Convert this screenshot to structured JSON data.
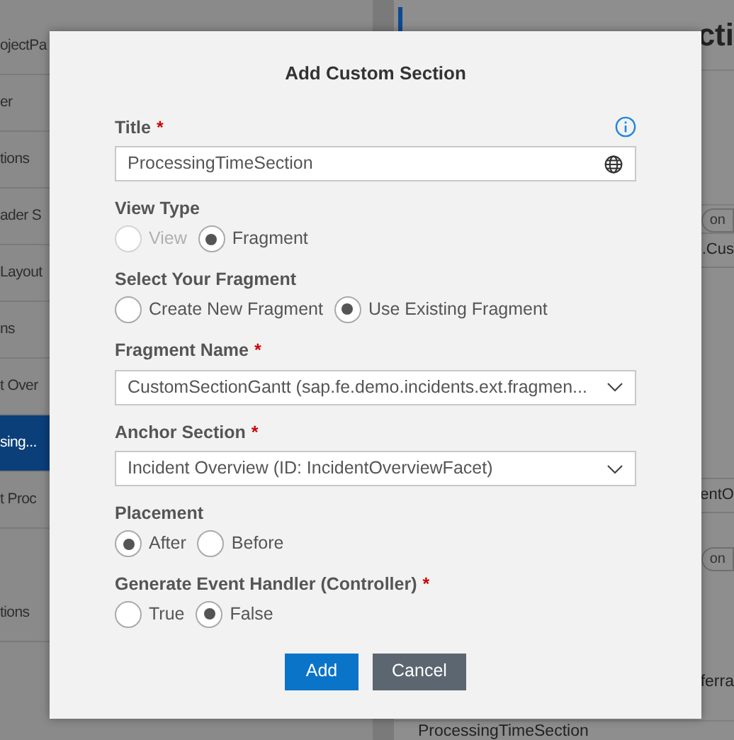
{
  "background": {
    "sidebar": {
      "items": [
        {
          "label": "ojectPa",
          "selected": false
        },
        {
          "label": "er",
          "selected": false
        },
        {
          "label": "tions",
          "selected": false
        },
        {
          "label": "ader S",
          "selected": false
        },
        {
          "label": "Layout",
          "selected": false
        },
        {
          "label": "ns",
          "selected": false
        },
        {
          "label": "t Over",
          "selected": false
        },
        {
          "label": "sing...",
          "selected": true
        },
        {
          "label": "t Proc",
          "selected": false
        },
        {
          "label": "tions",
          "selected": false
        }
      ]
    },
    "content": {
      "heading": "cti",
      "items": [
        {
          "kind": "pill",
          "text": "on"
        },
        {
          "kind": "field",
          "text": ".Cus"
        },
        {
          "kind": "field",
          "text": "entO"
        },
        {
          "kind": "pill",
          "text": "on"
        },
        {
          "kind": "plain",
          "text": "ferra"
        }
      ],
      "bottom_text": "ProcessingTimeSection"
    }
  },
  "dialog": {
    "title": "Add Custom Section",
    "fields": [
      {
        "kind": "text",
        "label": "Title",
        "required_mark": "*",
        "value": "ProcessingTimeSection"
      },
      {
        "kind": "radio",
        "label": "View Type",
        "options": [
          {
            "label": "View",
            "selected": false,
            "disabled": true
          },
          {
            "label": "Fragment",
            "selected": true,
            "disabled": false
          }
        ]
      },
      {
        "kind": "radio",
        "label": "Select Your Fragment",
        "options": [
          {
            "label": "Create New Fragment",
            "selected": false,
            "disabled": false
          },
          {
            "label": "Use Existing Fragment",
            "selected": true,
            "disabled": false
          }
        ]
      },
      {
        "kind": "select",
        "label": "Fragment Name",
        "required_mark": "*",
        "value": "CustomSectionGantt (sap.fe.demo.incidents.ext.fragmen..."
      },
      {
        "kind": "select",
        "label": "Anchor Section",
        "required_mark": "*",
        "value": "Incident Overview (ID: IncidentOverviewFacet)"
      },
      {
        "kind": "radio",
        "label": "Placement",
        "options": [
          {
            "label": "After",
            "selected": true,
            "disabled": false
          },
          {
            "label": "Before",
            "selected": false,
            "disabled": false
          }
        ]
      },
      {
        "kind": "radio",
        "label": "Generate Event Handler (Controller)",
        "required_mark": "*",
        "options": [
          {
            "label": "True",
            "selected": false,
            "disabled": false
          },
          {
            "label": "False",
            "selected": true,
            "disabled": false
          }
        ]
      }
    ],
    "buttons": [
      {
        "label": "Add",
        "kind": "primary"
      },
      {
        "label": "Cancel",
        "kind": "secondary"
      }
    ]
  }
}
